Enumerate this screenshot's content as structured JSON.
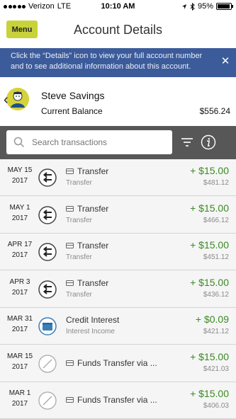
{
  "status_bar": {
    "carrier": "Verizon",
    "network": "LTE",
    "time": "10:10 AM",
    "battery": "95%",
    "battery_level": 0.95
  },
  "header": {
    "menu_label": "Menu",
    "title": "Account Details"
  },
  "banner": {
    "text": "Click the “Details” icon to view your full account number and to see additional information about this account.",
    "close_icon": "close-icon"
  },
  "account": {
    "name": "Steve Savings",
    "balance_label": "Current Balance",
    "balance_value": "$556.24"
  },
  "search": {
    "placeholder": "Search transactions"
  },
  "colors": {
    "menu_button": "#c8d23a",
    "banner": "#3c5b9a",
    "search_bar": "#575757",
    "amount_positive": "#3a8a22"
  },
  "transactions": [
    {
      "month_day": "MAY 15",
      "year": "2017",
      "icon": "transfer-icon",
      "title": "Transfer",
      "subtitle": "Transfer",
      "amount": "+ $15.00",
      "balance": "$481.12"
    },
    {
      "month_day": "MAY 1",
      "year": "2017",
      "icon": "transfer-icon",
      "title": "Transfer",
      "subtitle": "Transfer",
      "amount": "+ $15.00",
      "balance": "$466.12"
    },
    {
      "month_day": "APR 17",
      "year": "2017",
      "icon": "transfer-icon",
      "title": "Transfer",
      "subtitle": "Transfer",
      "amount": "+ $15.00",
      "balance": "$451.12"
    },
    {
      "month_day": "APR 3",
      "year": "2017",
      "icon": "transfer-icon",
      "title": "Transfer",
      "subtitle": "Transfer",
      "amount": "+ $15.00",
      "balance": "$436.12"
    },
    {
      "month_day": "MAR 31",
      "year": "2017",
      "icon": "interest-icon",
      "title": "Credit Interest",
      "subtitle": "Interest Income",
      "amount": "+ $0.09",
      "balance": "$421.12"
    },
    {
      "month_day": "MAR 15",
      "year": "2017",
      "icon": "uncategorized-icon",
      "title": "Funds Transfer via ...",
      "subtitle": "",
      "amount": "+ $15.00",
      "balance": "$421.03"
    },
    {
      "month_day": "MAR 1",
      "year": "2017",
      "icon": "uncategorized-icon",
      "title": "Funds Transfer via ...",
      "subtitle": "",
      "amount": "+ $15.00",
      "balance": "$406.03"
    }
  ]
}
